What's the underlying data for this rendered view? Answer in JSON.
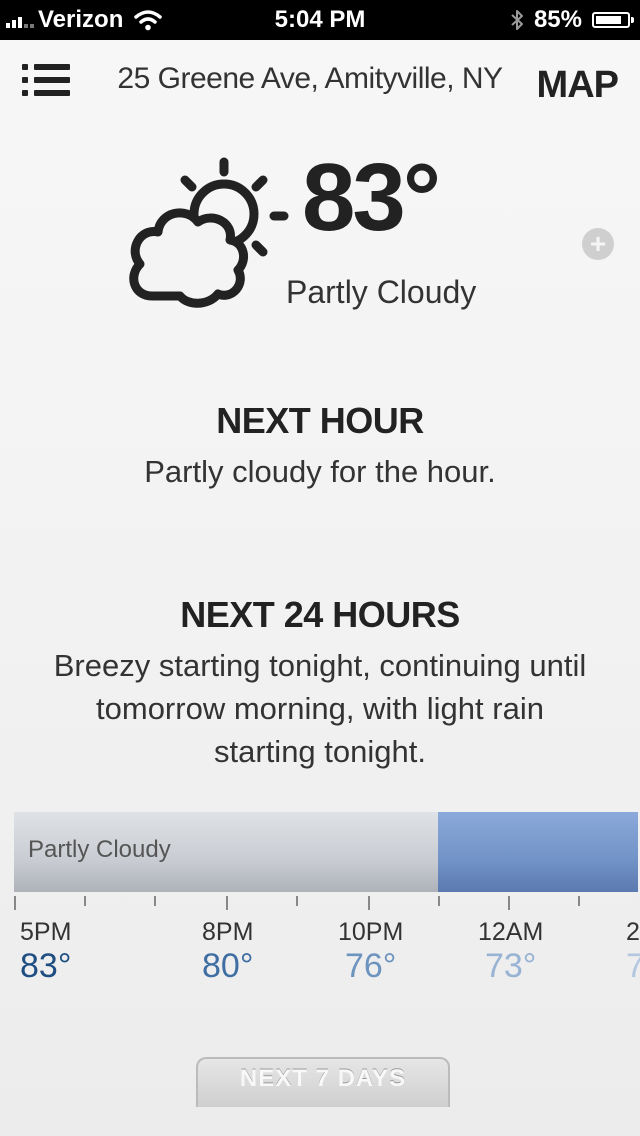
{
  "status_bar": {
    "carrier": "Verizon",
    "time": "5:04 PM",
    "battery": "85%",
    "battery_level": 0.85,
    "icons": [
      "signal-icon",
      "wifi-icon",
      "bluetooth-icon",
      "battery-icon"
    ]
  },
  "header": {
    "location": "25 Greene Ave, Amityville, NY",
    "map_label": "MAP",
    "menu_icon": "menu-icon"
  },
  "current": {
    "temperature": "83°",
    "condition": "Partly Cloudy",
    "icon": "partly-cloudy-icon",
    "add_icon": "plus-icon"
  },
  "next_hour": {
    "title": "NEXT HOUR",
    "summary": "Partly cloudy for the hour."
  },
  "next_24": {
    "title": "NEXT 24 HOURS",
    "summary": "Breezy starting tonight, continuing until tomorrow morning, with light rain starting tonight."
  },
  "timeline": {
    "segments": [
      {
        "label": "Partly Cloudy",
        "type": "cloudy"
      },
      {
        "label": "",
        "type": "rain"
      }
    ],
    "hours": [
      {
        "time": "5PM",
        "temp": "83°",
        "color": "#1f4e82"
      },
      {
        "time": "8PM",
        "temp": "80°",
        "color": "#3f6ea3"
      },
      {
        "time": "10PM",
        "temp": "76°",
        "color": "#6d93bf"
      },
      {
        "time": "12AM",
        "temp": "73°",
        "color": "#98b3d3"
      },
      {
        "time": "2",
        "temp": "7",
        "color": "#b3c8e0"
      }
    ]
  },
  "footer": {
    "next_7_days": "NEXT 7 DAYS"
  }
}
